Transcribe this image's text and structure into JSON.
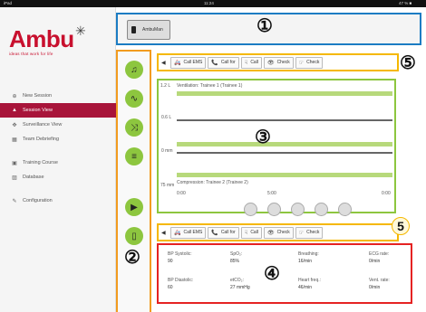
{
  "status_bar": {
    "left": "iPad",
    "center": "11:24",
    "right": "47 % ■"
  },
  "logo": {
    "text": "Ambu",
    "tagline": "ideas that work for life"
  },
  "nav": [
    {
      "icon": "⊕",
      "label": "New Session"
    },
    {
      "icon": "▲",
      "label": "Session View",
      "active": true
    },
    {
      "icon": "✥",
      "label": "Surveillance View"
    },
    {
      "icon": "▦",
      "label": "Team Debriefing"
    },
    {
      "icon": "▣",
      "label": "Training Course"
    },
    {
      "icon": "▨",
      "label": "Database"
    },
    {
      "icon": "✎",
      "label": "Configuration"
    }
  ],
  "device": {
    "label": "AmbuMan"
  },
  "callouts": {
    "one": "①",
    "two": "②",
    "three": "③",
    "four": "④",
    "five": "5"
  },
  "action_bar": {
    "arrow": "◀",
    "buttons": [
      {
        "icon": "🚑",
        "label": "Call EMS"
      },
      {
        "icon": "📞",
        "label": "Call for"
      },
      {
        "icon": "☟",
        "label": "Call"
      },
      {
        "icon": "👁",
        "label": "Check"
      },
      {
        "icon": "☞",
        "label": "Check"
      }
    ]
  },
  "graph": {
    "ventilation_scale": "1.2 L",
    "ventilation_title": "Ventilation: Trainee 1 (Trainee 1)",
    "mid_scale": "0.6 L",
    "zero_scale": "0 mm",
    "compression_scale": "75 mm",
    "compression_title": "Compression: Trainee 2 (Trainee 2)",
    "x_ticks": [
      "0:00",
      "5:00",
      "0:00"
    ]
  },
  "vitals": [
    {
      "label": "BP Systolic:",
      "value": "90"
    },
    {
      "label": "SpO₂:",
      "value": "85%"
    },
    {
      "label": "Breathing:",
      "value": "16/min"
    },
    {
      "label": "ECG rate:",
      "value": "0/min"
    },
    {
      "label": "BP Diastolic:",
      "value": "60"
    },
    {
      "label": "etCO₂:",
      "value": "27 mmHg"
    },
    {
      "label": "Heart freq.:",
      "value": "46/min"
    },
    {
      "label": "Vent. rate:",
      "value": "0/min"
    }
  ]
}
